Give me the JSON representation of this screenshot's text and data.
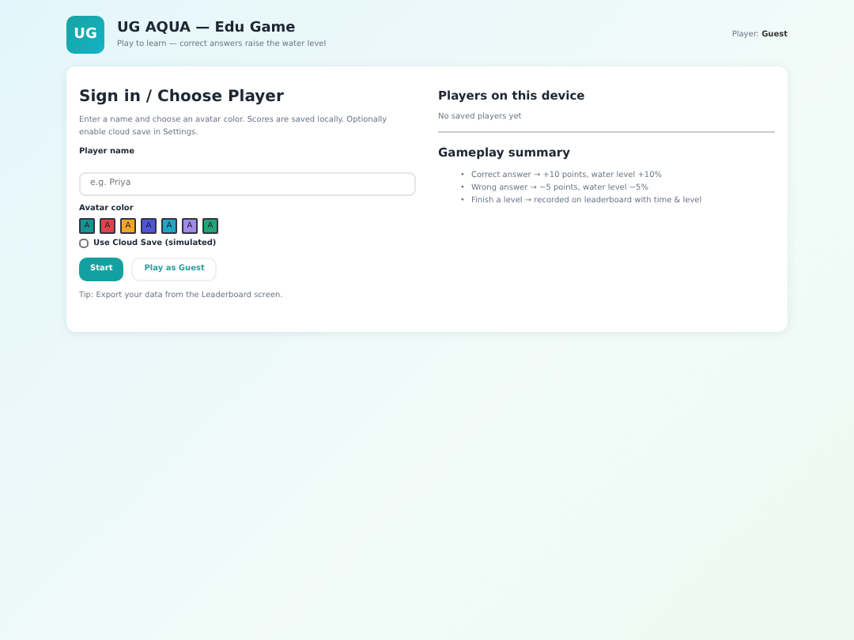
{
  "header": {
    "logo": "UG",
    "title": "UG AQUA — Edu Game",
    "subtitle": "Play to learn — correct answers raise the water level",
    "player_label": "Player:",
    "player_name": "Guest"
  },
  "signin": {
    "title": "Sign in / Choose Player",
    "intro": "Enter a name and choose an avatar color. Scores are saved locally. Optionally enable cloud save in Settings.",
    "name_label": "Player name",
    "name_placeholder": "e.g. Priya",
    "avatar_label": "Avatar color",
    "avatars": [
      {
        "letter": "A",
        "color": "#16948f"
      },
      {
        "letter": "A",
        "color": "#e0414a"
      },
      {
        "letter": "A",
        "color": "#f2a51f"
      },
      {
        "letter": "A",
        "color": "#4f55d6"
      },
      {
        "letter": "A",
        "color": "#1fa6c4"
      },
      {
        "letter": "A",
        "color": "#a08be6"
      },
      {
        "letter": "A",
        "color": "#22a474"
      }
    ],
    "cloud_save": {
      "label": "Use Cloud Save (simulated)",
      "checked": false
    },
    "buttons": [
      {
        "label": "Start",
        "kind": "primary"
      },
      {
        "label": "Play as Guest",
        "kind": "secondary"
      }
    ],
    "tip": "Tip: Export your data from the Leaderboard screen."
  },
  "players": {
    "title": "Players on this device",
    "empty": "No saved players yet"
  },
  "summary": {
    "title": "Gameplay summary",
    "items": [
      {
        "bullet": "•",
        "text": "Correct answer → +10 points, water level +10%"
      },
      {
        "bullet": "•",
        "text": "Wrong answer → −5 points, water level −5%"
      },
      {
        "bullet": "•",
        "text": "Finish a level → recorded on leaderboard with time & level"
      }
    ]
  }
}
